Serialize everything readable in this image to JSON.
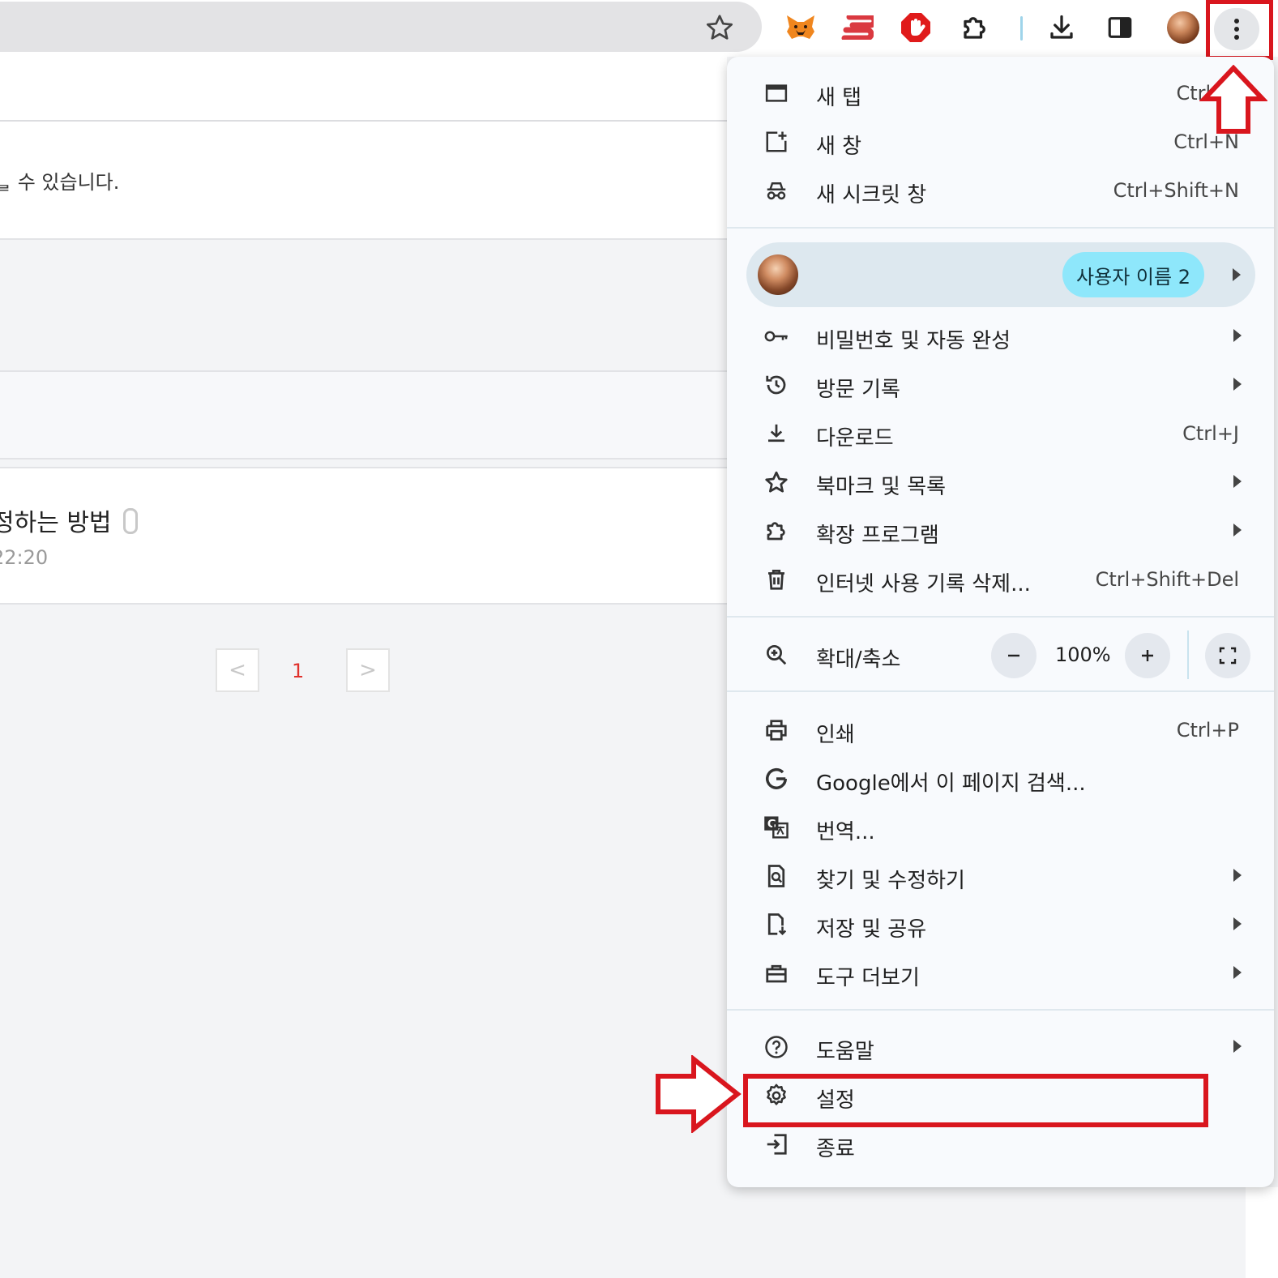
{
  "toolbar": {
    "icons": [
      "bookmark-star-icon",
      "metamask-fox-icon",
      "expressvpn-icon",
      "adblock-hand-icon",
      "extensions-puzzle-icon",
      "download-icon",
      "side-panel-icon",
      "profile-avatar",
      "more-menu-icon"
    ]
  },
  "page": {
    "notice_text": "ᆯ 수 있습니다.",
    "post_title": "정하는 방법",
    "post_date": "22:20",
    "pager": {
      "prev": "<",
      "current": "1",
      "next": ">"
    }
  },
  "menu": {
    "section1": [
      {
        "label": "새 탭",
        "shortcut": "Ctrl+T",
        "icon": "new-tab-icon"
      },
      {
        "label": "새 창",
        "shortcut": "Ctrl+N",
        "icon": "new-window-icon"
      },
      {
        "label": "새 시크릿 창",
        "shortcut": "Ctrl+Shift+N",
        "icon": "incognito-icon"
      }
    ],
    "profile": {
      "name": "사용자 이름 2"
    },
    "section2": [
      {
        "label": "비밀번호 및 자동 완성",
        "shortcut": "",
        "icon": "key-icon"
      },
      {
        "label": "방문 기록",
        "shortcut": "",
        "icon": "history-icon"
      },
      {
        "label": "다운로드",
        "shortcut": "Ctrl+J",
        "icon": "download-icon"
      },
      {
        "label": "북마크 및 목록",
        "shortcut": "",
        "icon": "star-icon"
      },
      {
        "label": "확장 프로그램",
        "shortcut": "",
        "icon": "puzzle-icon"
      },
      {
        "label": "인터넷 사용 기록 삭제...",
        "shortcut": "Ctrl+Shift+Del",
        "icon": "trash-icon"
      }
    ],
    "zoom": {
      "label": "확대/축소",
      "value": "100%",
      "minus": "−",
      "plus": "+"
    },
    "section3": [
      {
        "label": "인쇄",
        "shortcut": "Ctrl+P",
        "icon": "print-icon"
      },
      {
        "label": "Google에서 이 페이지 검색...",
        "shortcut": "",
        "icon": "google-icon"
      },
      {
        "label": "번역...",
        "shortcut": "",
        "icon": "translate-icon"
      },
      {
        "label": "찾기 및 수정하기",
        "shortcut": "",
        "icon": "find-icon"
      },
      {
        "label": "저장 및 공유",
        "shortcut": "",
        "icon": "save-share-icon"
      },
      {
        "label": "도구 더보기",
        "shortcut": "",
        "icon": "toolbox-icon"
      }
    ],
    "section4": [
      {
        "label": "도움말",
        "shortcut": "",
        "icon": "help-icon"
      },
      {
        "label": "설정",
        "shortcut": "",
        "icon": "gear-icon"
      },
      {
        "label": "종료",
        "shortcut": "",
        "icon": "exit-icon"
      }
    ]
  },
  "colors": {
    "highlight": "#d9161e",
    "profile_chip": "#8ee7fb",
    "menu_bg": "#f8fafd"
  }
}
